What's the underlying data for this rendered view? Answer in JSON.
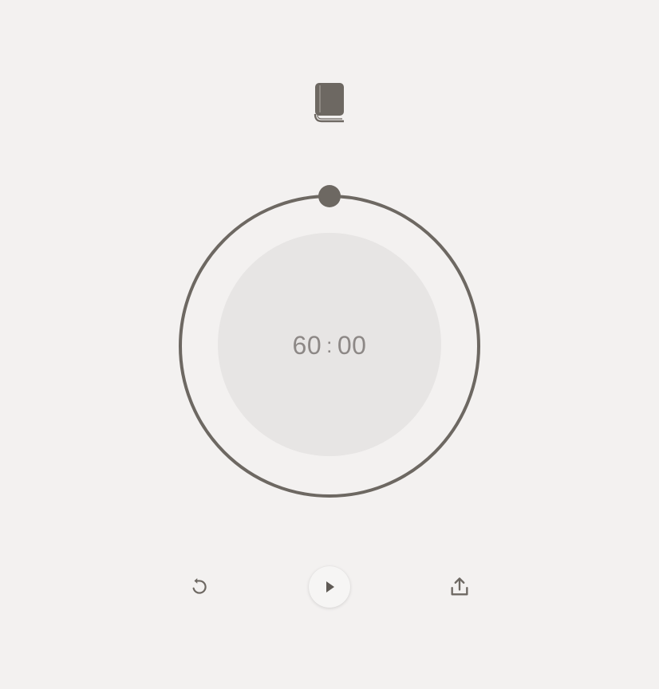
{
  "timer": {
    "minutes": "60",
    "separator": ":",
    "seconds": "00",
    "progress_fraction": 1.0
  },
  "icons": {
    "header": "book-icon",
    "reset": "reset-icon",
    "play": "play-icon",
    "share": "share-icon"
  },
  "colors": {
    "background": "#f3f1f0",
    "ring": "#6d6862",
    "face": "#e7e5e4",
    "text": "#8d8886",
    "icon": "#6d6862"
  }
}
